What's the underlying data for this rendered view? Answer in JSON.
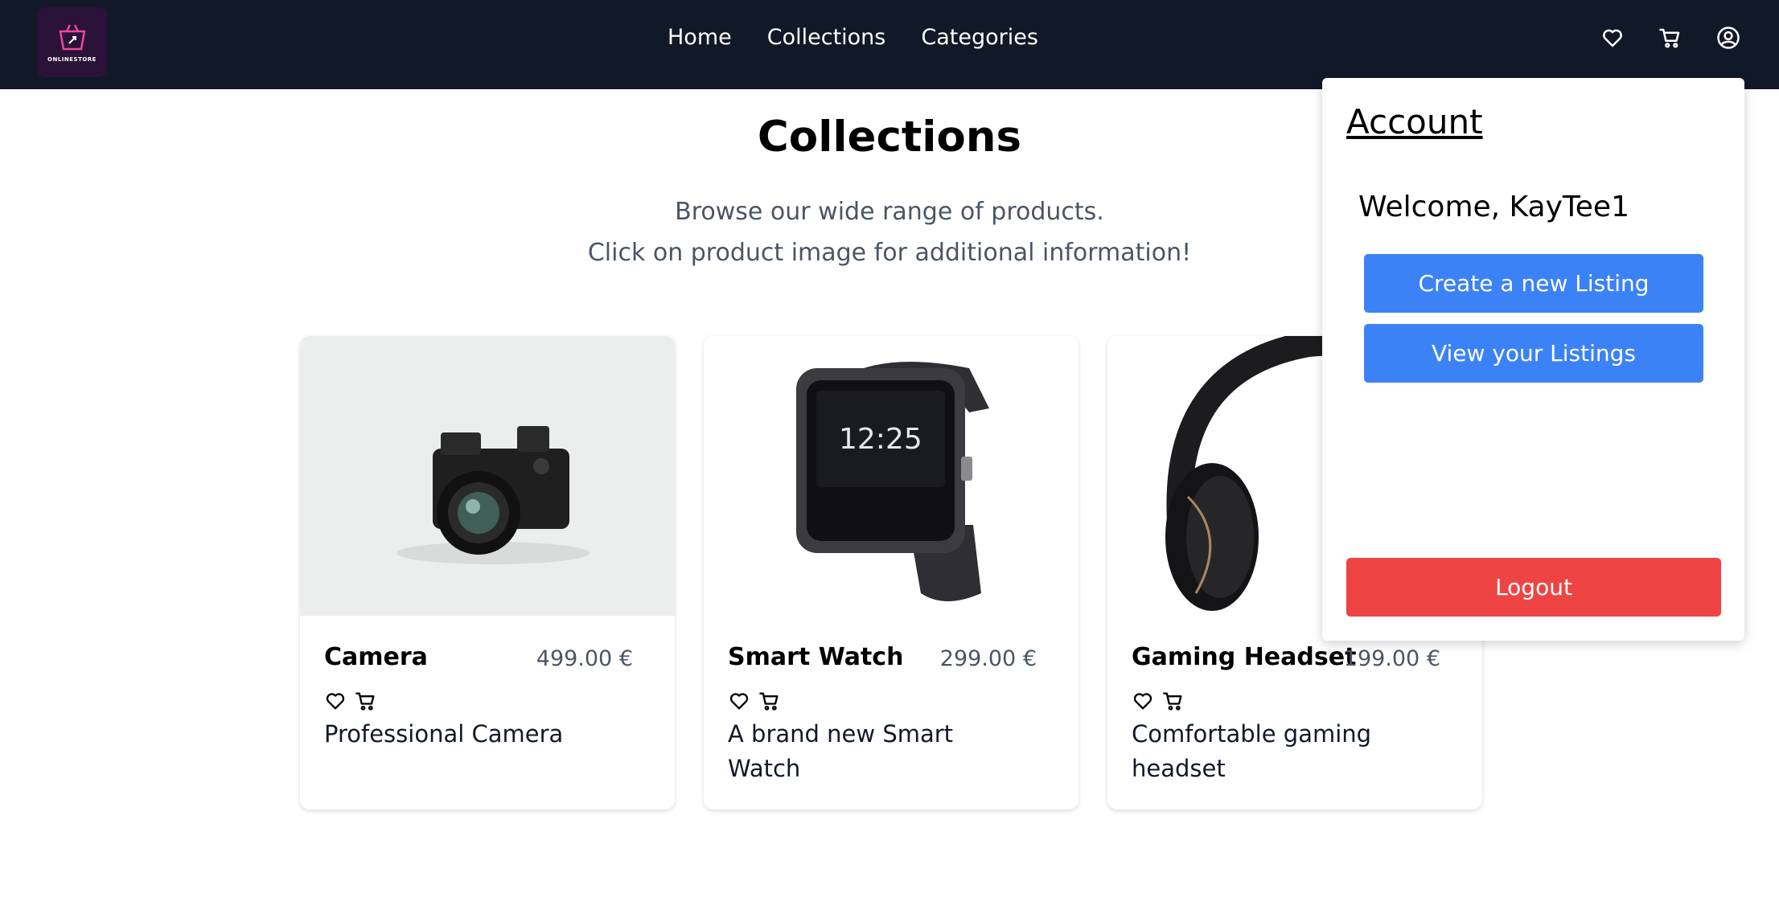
{
  "navbar": {
    "logo_text": "ONLINESTORE",
    "links": [
      "Home",
      "Collections",
      "Categories"
    ],
    "icons": [
      "heart-icon",
      "cart-icon",
      "user-circle-icon"
    ],
    "background": "#111827"
  },
  "main": {
    "title": "Collections",
    "subtitle_line1": "Browse our wide range of products.",
    "subtitle_line2": "Click on product image for additional information!"
  },
  "products": [
    {
      "name": "Camera",
      "price": "499.00 €",
      "description": "Professional Camera"
    },
    {
      "name": "Smart Watch",
      "price": "299.00 €",
      "description": "A brand new Smart Watch"
    },
    {
      "name": "Gaming Headset",
      "price": "199.00 €",
      "description": "Comfortable gaming headset"
    }
  ],
  "account": {
    "title": "Account",
    "welcome": "Welcome, KayTee1",
    "create_label": "Create a new Listing",
    "view_label": "View your Listings",
    "logout_label": "Logout",
    "primary_color": "#3b82f6",
    "danger_color": "#ef4444"
  }
}
